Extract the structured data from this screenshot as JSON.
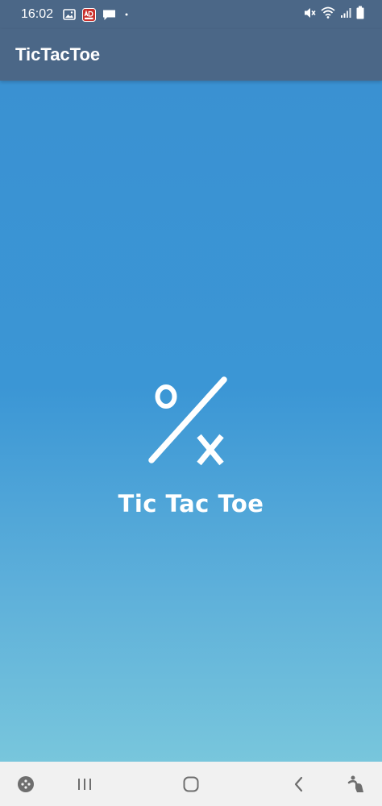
{
  "status_bar": {
    "time": "16:02",
    "notification_icons": [
      "image-icon",
      "ad-app-icon",
      "chat-bubble-icon",
      "dot-icon"
    ],
    "system_icons": [
      "mute-icon",
      "wifi-icon",
      "signal-icon",
      "battery-icon"
    ]
  },
  "app_bar": {
    "title": "TicTacToe"
  },
  "splash": {
    "logo_icon": "tic-tac-toe-logo-icon",
    "title": "Tic Tac Toe"
  },
  "nav_bar": {
    "buttons": [
      "game-launcher-icon",
      "recents-icon",
      "home-icon",
      "back-icon",
      "accessibility-icon"
    ]
  },
  "colors": {
    "app_bar": "#4b6787",
    "gradient_top": "#3a91d2",
    "gradient_bottom": "#78c6dc",
    "nav_bar": "#f1f1f1",
    "text": "#ffffff"
  }
}
